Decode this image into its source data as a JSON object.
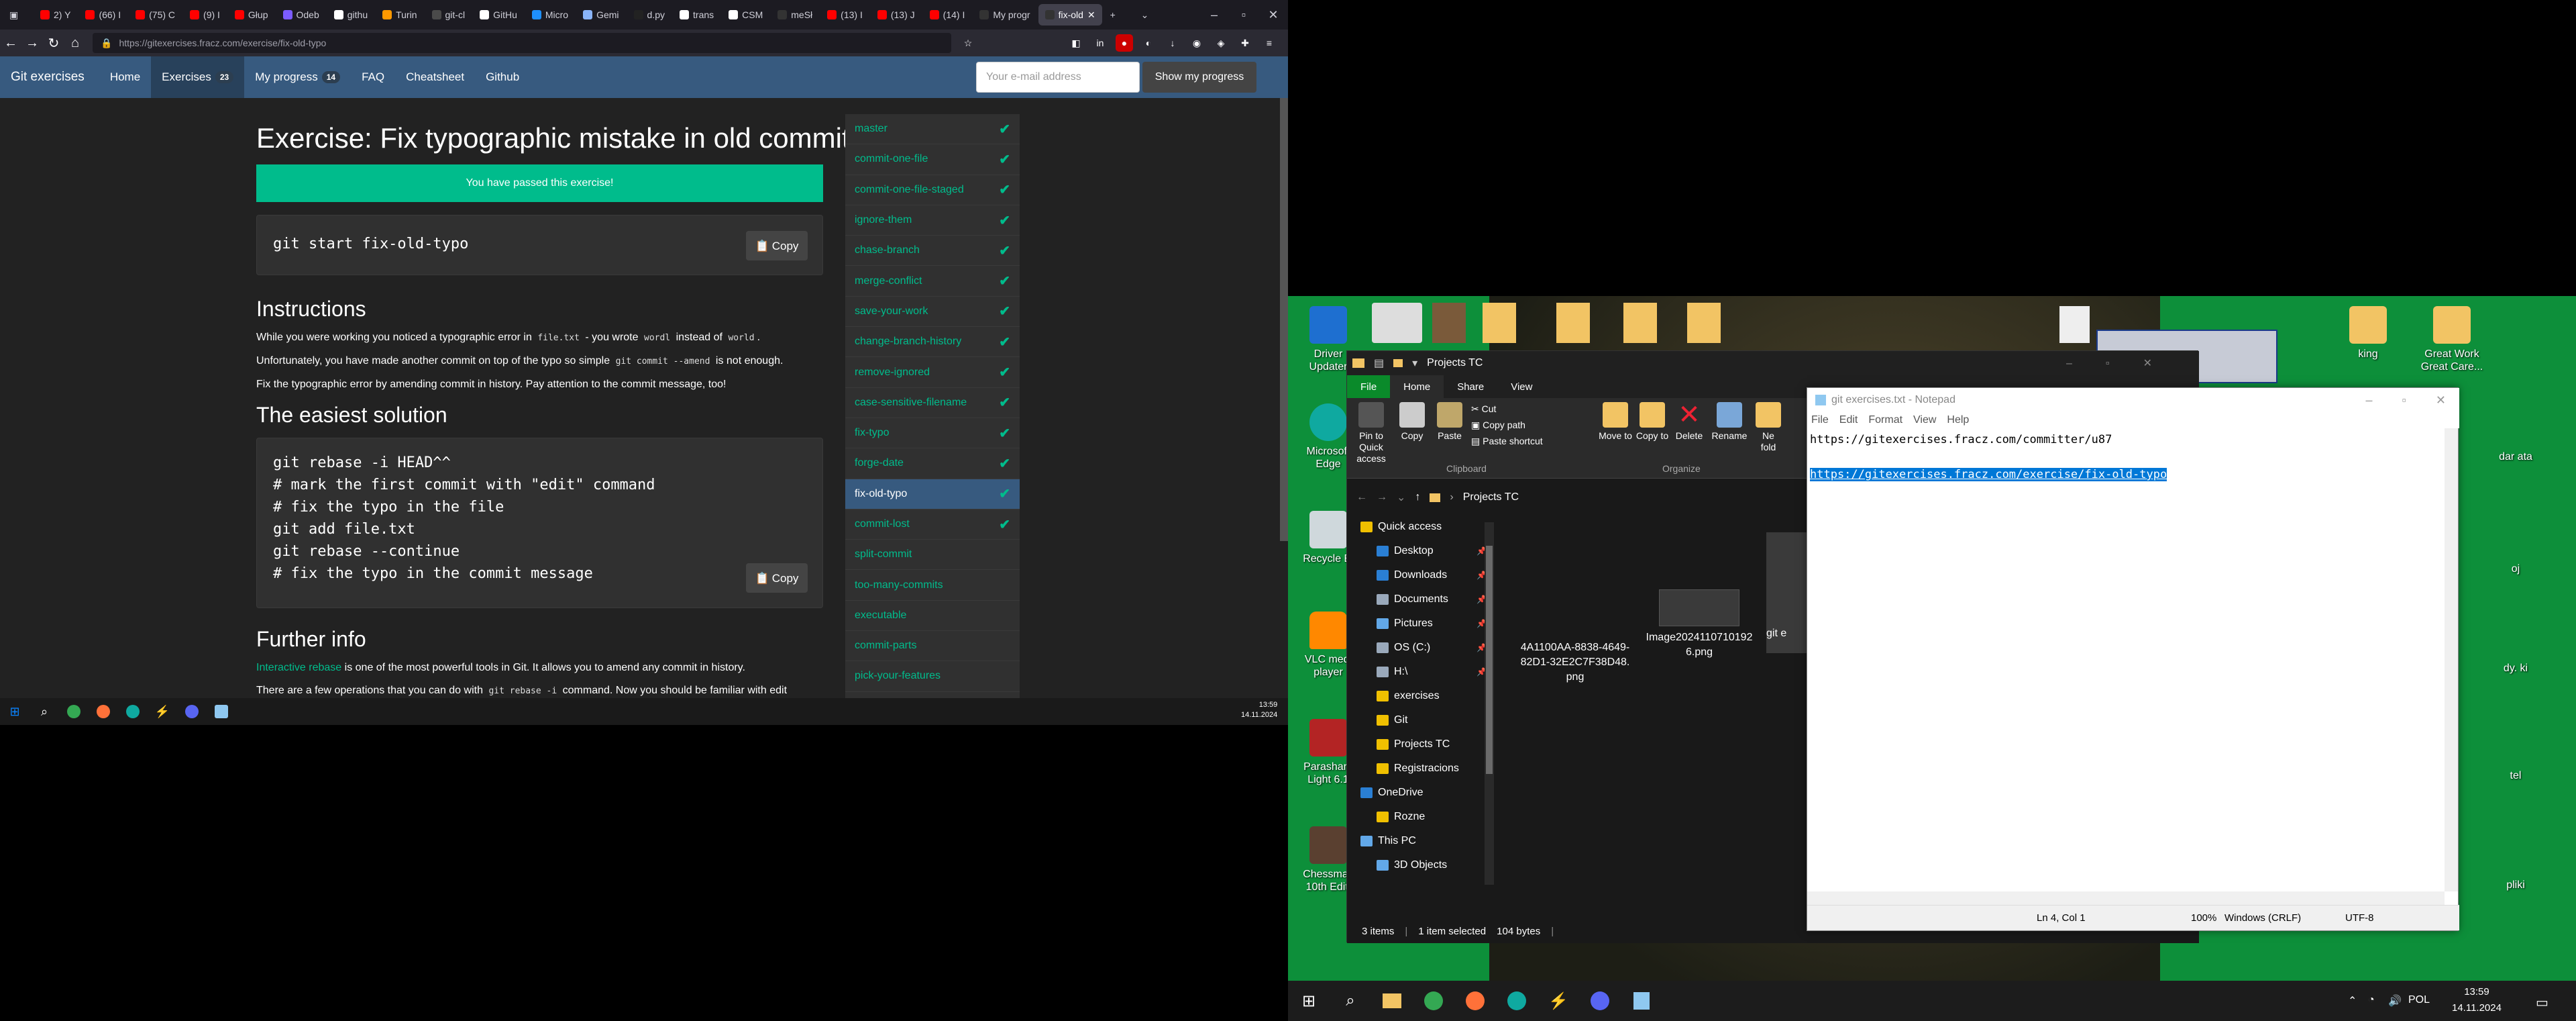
{
  "browser": {
    "tabs": [
      {
        "label": "2) Y",
        "color": "#ff0000"
      },
      {
        "label": "(66) I",
        "color": "#ff0000"
      },
      {
        "label": "(75) C",
        "color": "#ff0000"
      },
      {
        "label": "(9) I",
        "color": "#ff0000"
      },
      {
        "label": "Głup",
        "color": "#ff0000"
      },
      {
        "label": "Odeb",
        "color": "#7b5cff"
      },
      {
        "label": "githu",
        "color": "#ffffff"
      },
      {
        "label": "Turin",
        "color": "#ff9900"
      },
      {
        "label": "git-cl",
        "color": "#4a4a4a"
      },
      {
        "label": "GitHu",
        "color": "#ffffff"
      },
      {
        "label": "Micro",
        "color": "#1e90ff"
      },
      {
        "label": "Gemi",
        "color": "#8ab4f8"
      },
      {
        "label": "d.py",
        "color": "#222222"
      },
      {
        "label": "trans",
        "color": "#ffffff"
      },
      {
        "label": "CSM",
        "color": "#ffffff"
      },
      {
        "label": "meSł",
        "color": "#333333"
      },
      {
        "label": "(13) I",
        "color": "#ff0000"
      },
      {
        "label": "(13) J",
        "color": "#ff0000"
      },
      {
        "label": "(14) I",
        "color": "#ff0000"
      },
      {
        "label": "My progr",
        "color": "#333333"
      },
      {
        "label": "fix-old",
        "color": "#333333"
      }
    ],
    "url": "https://gitexercises.fracz.com/exercise/fix-old-typo",
    "url_domain": "fracz.com"
  },
  "site": {
    "brand": "Git exercises",
    "nav": {
      "home": "Home",
      "exercises": "Exercises",
      "exercises_count": "23",
      "progress": "My progress",
      "progress_count": "14",
      "faq": "FAQ",
      "cheatsheet": "Cheatsheet",
      "github": "Github"
    },
    "email_placeholder": "Your e-mail address",
    "show_progress": "Show my progress"
  },
  "exercise": {
    "title": "Exercise: Fix typographic mistake in old commit",
    "passed": "You have passed this exercise!",
    "start_cmd": "git start fix-old-typo",
    "copy": "Copy",
    "instructions_heading": "Instructions",
    "instr_1a": "While you were working you noticed a typographic error in",
    "instr_1b": "file.txt",
    "instr_1c": "- you wrote",
    "instr_1d": "wordl",
    "instr_1e": "instead of",
    "instr_1f": "world",
    "instr_1g": ".",
    "instr_2a": "Unfortunately, you have made another commit on top of the typo so simple",
    "instr_2b": "git commit --amend",
    "instr_2c": "is not enough.",
    "instr_3": "Fix the typographic error by amending commit in history. Pay attention to the commit message, too!",
    "easiest_heading": "The easiest solution",
    "solution_lines": [
      "git rebase -i HEAD^^",
      "# mark the first commit with \"edit\" command",
      "# fix the typo in the file",
      "git add file.txt",
      "git rebase --continue",
      "# fix the typo in the commit message"
    ],
    "further_heading": "Further info",
    "further_link": "Interactive rebase",
    "further_1": "is one of the most powerful tools in Git. It allows you to amend any commit in history.",
    "further_2a": "There are a few operations that you can do with",
    "further_2b": "git rebase -i",
    "further_2c": "command. Now you should be familiar with edit"
  },
  "exercise_list": [
    {
      "name": "master",
      "done": true
    },
    {
      "name": "commit-one-file",
      "done": true
    },
    {
      "name": "commit-one-file-staged",
      "done": true
    },
    {
      "name": "ignore-them",
      "done": true
    },
    {
      "name": "chase-branch",
      "done": true
    },
    {
      "name": "merge-conflict",
      "done": true
    },
    {
      "name": "save-your-work",
      "done": true
    },
    {
      "name": "change-branch-history",
      "done": true
    },
    {
      "name": "remove-ignored",
      "done": true
    },
    {
      "name": "case-sensitive-filename",
      "done": true
    },
    {
      "name": "fix-typo",
      "done": true
    },
    {
      "name": "forge-date",
      "done": true
    },
    {
      "name": "fix-old-typo",
      "done": true
    },
    {
      "name": "commit-lost",
      "done": true
    },
    {
      "name": "split-commit",
      "done": false
    },
    {
      "name": "too-many-commits",
      "done": false
    },
    {
      "name": "executable",
      "done": false
    },
    {
      "name": "commit-parts",
      "done": false
    },
    {
      "name": "pick-your-features",
      "done": false
    }
  ],
  "taskbar_left": {
    "time": "13:59",
    "date": "14.11.2024"
  },
  "desktop_icons": {
    "driver": "Driver Updater",
    "edge": "Microsoft Edge",
    "recycle": "Recycle Bi",
    "vlc": "VLC medi player",
    "parashara": "Parashara Light 6.1",
    "chessmaster": "Chessmas 10th Editi",
    "king": "king",
    "great_work": "Great Work Great Care...",
    "right_1": "dar ata",
    "right_2": "oj",
    "right_3": "dy. ki",
    "right_4": "tel",
    "right_5": "pliki"
  },
  "explorer": {
    "title": "Projects TC",
    "ribbon_tabs": [
      "File",
      "Home",
      "Share",
      "View"
    ],
    "pin": "Pin to Quick access",
    "copy": "Copy",
    "paste": "Paste",
    "cut": "Cut",
    "copy_path": "Copy path",
    "paste_shortcut": "Paste shortcut",
    "clipboard": "Clipboard",
    "move_to": "Move to",
    "copy_to": "Copy to",
    "delete": "Delete",
    "rename": "Rename",
    "new_folder": "Ne fold",
    "organize": "Organize",
    "address": "Projects TC",
    "nav": [
      {
        "label": "Quick access",
        "color": "#f0c000",
        "pin": false,
        "indent": 1
      },
      {
        "label": "Desktop",
        "color": "#2a7fd4",
        "pin": true,
        "indent": 2
      },
      {
        "label": "Downloads",
        "color": "#2a7fd4",
        "pin": true,
        "indent": 2
      },
      {
        "label": "Documents",
        "color": "#9aa9bb",
        "pin": true,
        "indent": 2
      },
      {
        "label": "Pictures",
        "color": "#62a8e8",
        "pin": true,
        "indent": 2
      },
      {
        "label": "OS (C:)",
        "color": "#9aa9bb",
        "pin": true,
        "indent": 2
      },
      {
        "label": "H:\\",
        "color": "#9aa9bb",
        "pin": true,
        "indent": 2
      },
      {
        "label": "exercises",
        "color": "#f0c000",
        "pin": false,
        "indent": 2
      },
      {
        "label": "Git",
        "color": "#f0c000",
        "pin": false,
        "indent": 2
      },
      {
        "label": "Projects TC",
        "color": "#f0c000",
        "pin": false,
        "indent": 2
      },
      {
        "label": "Registracions",
        "color": "#f0c000",
        "pin": false,
        "indent": 2
      },
      {
        "label": "OneDrive",
        "color": "#2a7fd4",
        "pin": false,
        "indent": 1
      },
      {
        "label": "Rozne",
        "color": "#f0c000",
        "pin": false,
        "indent": 2
      },
      {
        "label": "This PC",
        "color": "#62a8e8",
        "pin": false,
        "indent": 1
      },
      {
        "label": "3D Objects",
        "color": "#62a8e8",
        "pin": false,
        "indent": 2
      }
    ],
    "files": [
      "4A1100AA-8838-4649-82D1-32E2C7F38D48.png",
      "Image20241107101926.png",
      "git e"
    ],
    "status_items": "3 items",
    "status_selected": "1 item selected",
    "status_size": "104 bytes"
  },
  "notepad": {
    "title": "git exercises.txt - Notepad",
    "menu": [
      "File",
      "Edit",
      "Format",
      "View",
      "Help"
    ],
    "line1": "https://gitexercises.fracz.com/committer/u87",
    "line3": "https://gitexercises.fracz.com/exercise/fix-old-typo",
    "pos": "Ln 4, Col 1",
    "zoom": "100%",
    "eol": "Windows (CRLF)",
    "enc": "UTF-8"
  },
  "taskbar_right": {
    "time": "13:59",
    "date": "14.11.2024",
    "lang": "POL"
  }
}
